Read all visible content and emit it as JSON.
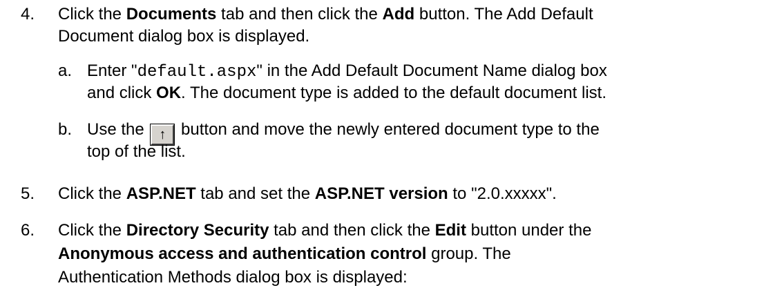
{
  "steps": [
    {
      "number": "4.",
      "lines": [
        [
          "Click the ",
          {
            "b": "Documents"
          },
          " tab and then click the ",
          {
            "b": "Add"
          },
          " button. The Add Default"
        ],
        [
          "Document dialog box is displayed."
        ]
      ],
      "substeps": [
        {
          "letter": "a.",
          "lines": [
            [
              "Enter \"",
              {
                "code": "default.aspx"
              },
              "\" in the Add Default Document Name dialog box"
            ],
            [
              "and click ",
              {
                "b": "OK"
              },
              ". The document type is added to the default document list."
            ]
          ]
        },
        {
          "letter": "b.",
          "lines": [
            [
              "Use the ",
              {
                "icon": "move-up-arrow-button",
                "glyph": "↑"
              },
              " button and move the newly entered document type to the"
            ],
            [
              "top of the list."
            ]
          ]
        }
      ]
    },
    {
      "number": "5.",
      "lines": [
        [
          "Click the ",
          {
            "b": "ASP.NET"
          },
          " tab and set the ",
          {
            "b": "ASP.NET version"
          },
          " to \"2.0.xxxxx\"."
        ]
      ]
    },
    {
      "number": "6.",
      "lines": [
        [
          "Click the ",
          {
            "b": "Directory Security"
          },
          " tab and then click the ",
          {
            "b": "Edit"
          },
          " button under the"
        ],
        [
          {
            "b": "Anonymous access and authentication control"
          },
          " group. The"
        ],
        [
          "Authentication Methods dialog box is displayed:"
        ]
      ]
    }
  ]
}
